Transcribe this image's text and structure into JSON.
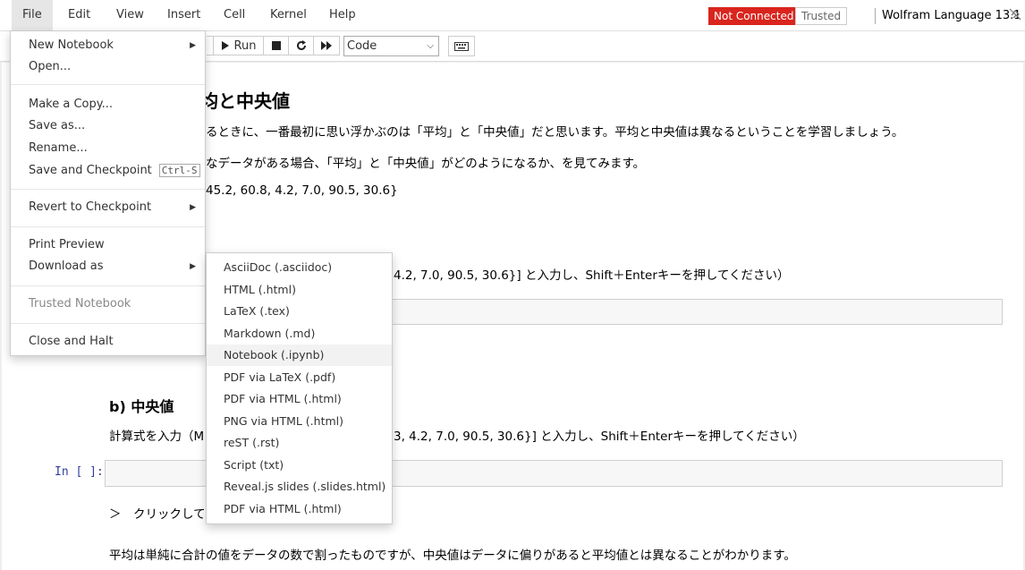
{
  "menubar": {
    "items": [
      "File",
      "Edit",
      "View",
      "Insert",
      "Cell",
      "Kernel",
      "Help"
    ],
    "not_connected": "Not Connected",
    "trusted": "Trusted",
    "kernel_name": "Wolfram Language 13.1"
  },
  "toolbar": {
    "run_label": "Run",
    "cell_type": "Code"
  },
  "notebook": {
    "title_fragment": "均と中央値",
    "intro_line": "るときに、一番最初に思い浮かぶのは「平均」と「中央値」だと思います。平均と中央値は異なるということを学習しましょう。",
    "data_line": "なデータがある場合、「平均」と「中央値」がどのようになるか、を見てみます。",
    "data_values": "45.2, 60.8, 4.2, 7.0, 90.5, 30.6}",
    "instruction_a_fragment": "4.2, 7.0, 90.5, 30.6}] と入力し、Shift＋Enterキーを押してください）",
    "section_b_title": "b) 中央値",
    "instruction_b_start": "計算式を入力（M",
    "instruction_b_end": "3, 4.2, 7.0, 90.5, 30.6}] と入力し、Shift＋Enterキーを押してください）",
    "prompt": "In [ ]:",
    "click_line": "＞　クリックして",
    "summary": "平均は単純に合計の値をデータの数で割ったものですが、中央値はデータに偏りがあると平均値とは異なることがわかります。"
  },
  "file_menu": {
    "items": [
      {
        "label": "New Notebook",
        "submenu": true
      },
      {
        "label": "Open..."
      },
      {
        "label": "Make a Copy..."
      },
      {
        "label": "Save as..."
      },
      {
        "label": "Rename..."
      },
      {
        "label": "Save and Checkpoint",
        "shortcut": "Ctrl-S"
      },
      {
        "label": "Revert to Checkpoint",
        "submenu": true
      },
      {
        "label": "Print Preview"
      },
      {
        "label": "Download as",
        "submenu": true
      },
      {
        "label": "Trusted Notebook",
        "disabled": true
      },
      {
        "label": "Close and Halt"
      }
    ]
  },
  "download_submenu": {
    "items": [
      "AsciiDoc (.asciidoc)",
      "HTML (.html)",
      "LaTeX (.tex)",
      "Markdown (.md)",
      "Notebook (.ipynb)",
      "PDF via LaTeX (.pdf)",
      "PDF via HTML (.html)",
      "PNG via HTML (.html)",
      "reST (.rst)",
      "Script (txt)",
      "Reveal.js slides (.slides.html)",
      "PDF via HTML (.html)"
    ],
    "highlighted": "Notebook (.ipynb)"
  },
  "colors": {
    "not_connected_bg": "#d9251d",
    "prompt": "#303f9f",
    "menu_highlight": "#f2f2f2"
  }
}
